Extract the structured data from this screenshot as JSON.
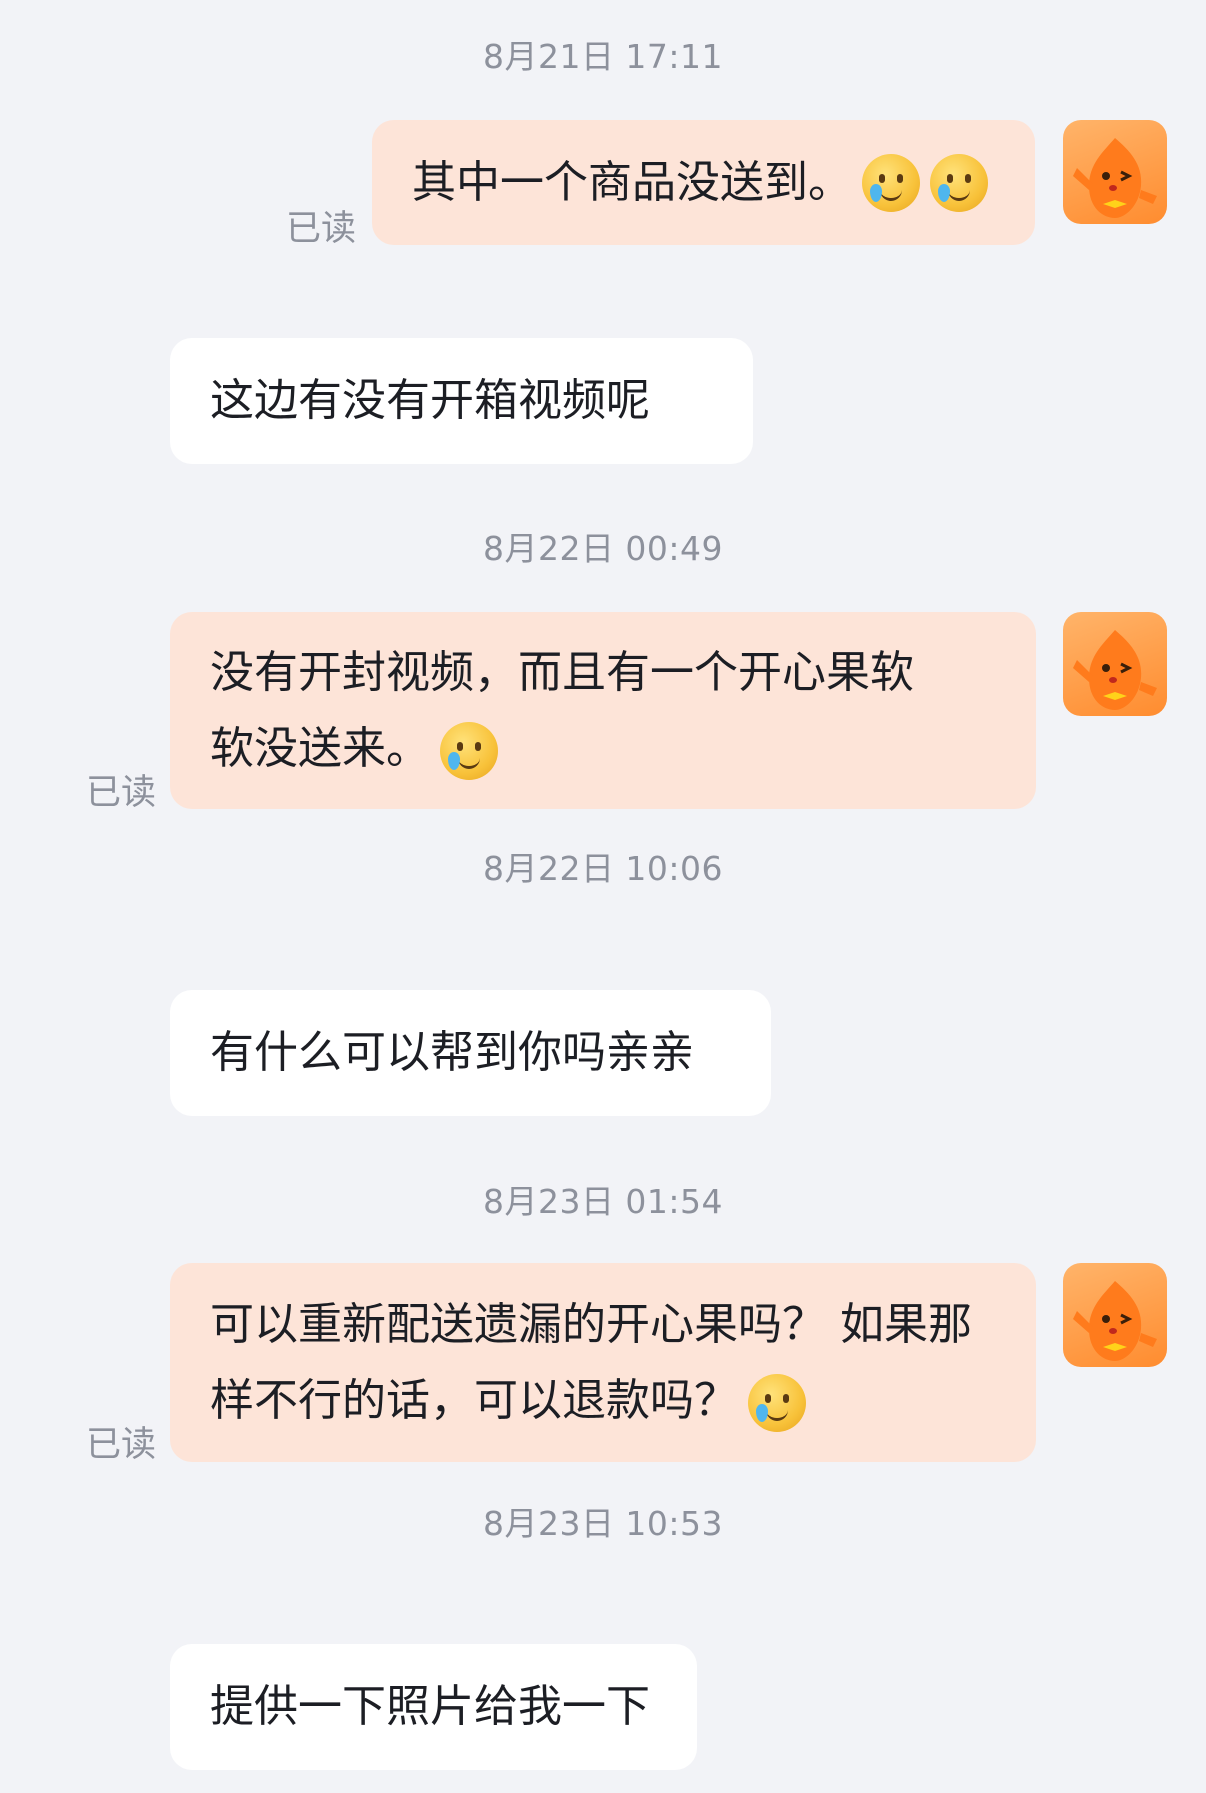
{
  "timestamps": [
    "8月21日 17:11",
    "8月22日 00:49",
    "8月22日 10:06",
    "8月23日 01:54",
    "8月23日 10:53"
  ],
  "read_label": "已读",
  "messages": [
    {
      "side": "right",
      "text": "其中一个商品没送到。",
      "emoji": [
        "crying-smile-emoji",
        "crying-smile-emoji"
      ]
    },
    {
      "side": "left",
      "text": "这边有没有开箱视频呢"
    },
    {
      "side": "right",
      "text": "没有开封视频，而且有一个开心果软软没送来。",
      "emoji": [
        "crying-smile-emoji"
      ]
    },
    {
      "side": "left",
      "text": "有什么可以帮到你吗亲亲"
    },
    {
      "side": "right",
      "text": "可以重新配送遗漏的开心果吗？ 如果那样不行的话，可以退款吗？",
      "emoji": [
        "crying-smile-emoji"
      ]
    },
    {
      "side": "left",
      "text": "提供一下照片给我一下"
    }
  ],
  "avatar_icon": "orange-mascot-avatar-icon",
  "colors": {
    "background": "#f2f3f7",
    "right_bubble": "#fde4d8",
    "left_bubble": "#ffffff",
    "meta_text": "#8d919c"
  }
}
